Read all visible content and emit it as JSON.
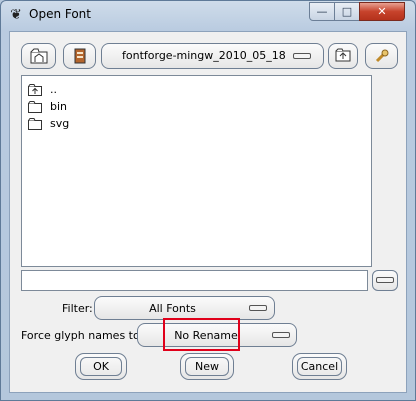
{
  "window": {
    "title": "Open Font",
    "app_icon": "fontforge-icon",
    "controls": {
      "minimize": "—",
      "maximize": "□",
      "close": "✕"
    }
  },
  "toolbar": {
    "home_icon": "home-folder-icon",
    "bookmark_icon": "bookmark-icon",
    "path_value": "fontforge-mingw_2010_05_18",
    "up_icon": "parent-folder-icon",
    "config_icon": "wrench-icon"
  },
  "files": [
    {
      "name": "..",
      "type": "parent"
    },
    {
      "name": "bin",
      "type": "folder"
    },
    {
      "name": "svg",
      "type": "folder"
    }
  ],
  "filename_field": {
    "value": ""
  },
  "filter": {
    "label": "Filter:",
    "value": "All Fonts"
  },
  "glyph_names": {
    "label": "Force glyph names to:",
    "value": "No Rename"
  },
  "buttons": {
    "ok": "OK",
    "new": "New",
    "cancel": "Cancel"
  },
  "colors": {
    "highlight": "#e0001a",
    "close_button": "#c7432c"
  }
}
